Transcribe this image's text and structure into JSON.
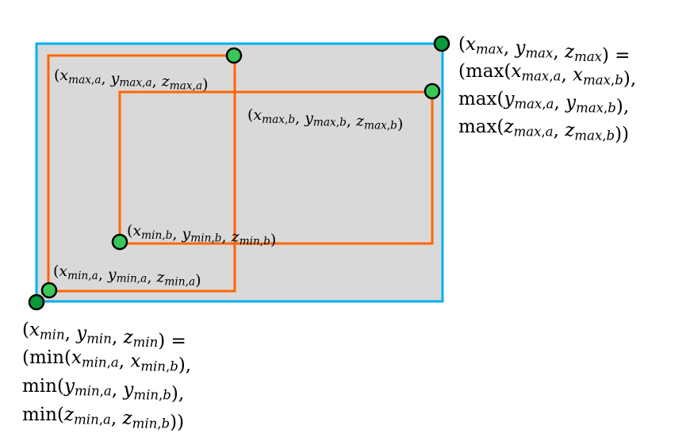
{
  "colors": {
    "union_box_fill": "#d9d9d9",
    "union_box_stroke": "#00b0f0",
    "box_stroke": "#ff6600",
    "corner_fill_a": "#39c758",
    "corner_fill_b": "#0a9a3c",
    "corner_stroke": "#000000"
  },
  "labels": {
    "max_a": "(x_{max,a}, y_{max,a}, z_{max,a})",
    "max_b": "(x_{max,b}, y_{max,b}, z_{max,b})",
    "min_a": "(x_{min,a}, y_{min,a}, z_{min,a})",
    "min_b": "(x_{min,b}, y_{min,b}, z_{min,b})",
    "max_union": [
      "(x_{max}, y_{max}, z_{max}) =",
      "(max(x_{max,a}, x_{max,b}),",
      " max(y_{max,a}, y_{max,b}),",
      " max(z_{max,a}, z_{max,b}))"
    ],
    "min_union": [
      "(x_{min}, y_{min}, z_{min}) =",
      "(min(x_{min,a}, x_{min,b}),",
      " min(y_{min,a}, y_{min,b}),",
      " min(z_{min,a}, z_{min,b}))"
    ]
  }
}
